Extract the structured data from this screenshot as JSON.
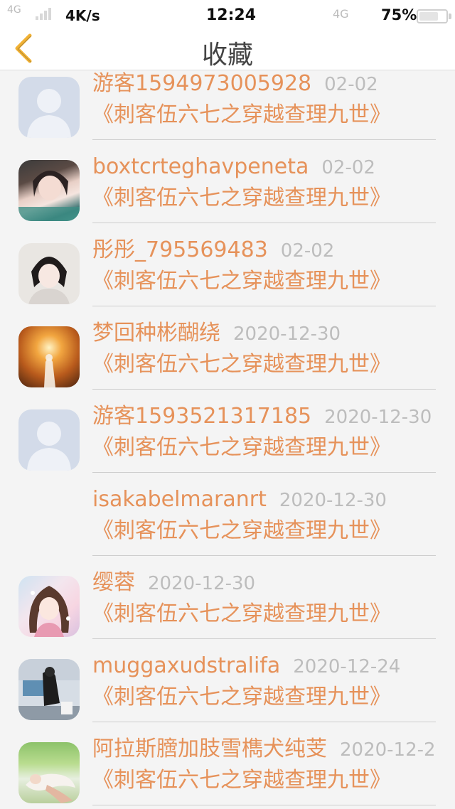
{
  "status_bar": {
    "carrier_left": "4G",
    "speed": "4K/s",
    "time": "12:24",
    "carrier_right": "4G",
    "battery": "75%"
  },
  "nav": {
    "title": "收藏",
    "back_icon": "chevron-left-icon"
  },
  "colors": {
    "accent": "#e6925a",
    "date": "#bdbdbd",
    "back_icon": "#f2b234"
  },
  "items": [
    {
      "name": "游客1594973005928",
      "date": "02-02",
      "book": "《刺客伍六七之穿越查理九世》",
      "avatar": "default-avatar"
    },
    {
      "name": "boxtcrteghavpeneta",
      "date": "02-02",
      "book": "《刺客伍六七之穿越查理九世》",
      "avatar": "photo-avatar"
    },
    {
      "name": "彤彤_795569483",
      "date": "02-02",
      "book": "《刺客伍六七之穿越查理九世》",
      "avatar": "photo-avatar"
    },
    {
      "name": "梦回种彬醐绕",
      "date": "2020-12-30",
      "book": "《刺客伍六七之穿越查理九世》",
      "avatar": "photo-avatar"
    },
    {
      "name": "游客1593521317185",
      "date": "2020-12-30",
      "book": "《刺客伍六七之穿越查理九世》",
      "avatar": "default-avatar"
    },
    {
      "name": "isakabelmaranrt",
      "date": "2020-12-30",
      "book": "《刺客伍六七之穿越查理九世》",
      "avatar": "none"
    },
    {
      "name": "缨蓉",
      "date": "2020-12-30",
      "book": "《刺客伍六七之穿越查理九世》",
      "avatar": "anime-avatar"
    },
    {
      "name": "muggaxudstralifa",
      "date": "2020-12-24",
      "book": "《刺客伍六七之穿越查理九世》",
      "avatar": "photo-avatar"
    },
    {
      "name": "阿拉斯膪加肢雪檇犬纯芰",
      "date": "2020-12-2",
      "book": "《刺客伍六七之穿越查理九世》",
      "avatar": "photo-avatar"
    }
  ]
}
